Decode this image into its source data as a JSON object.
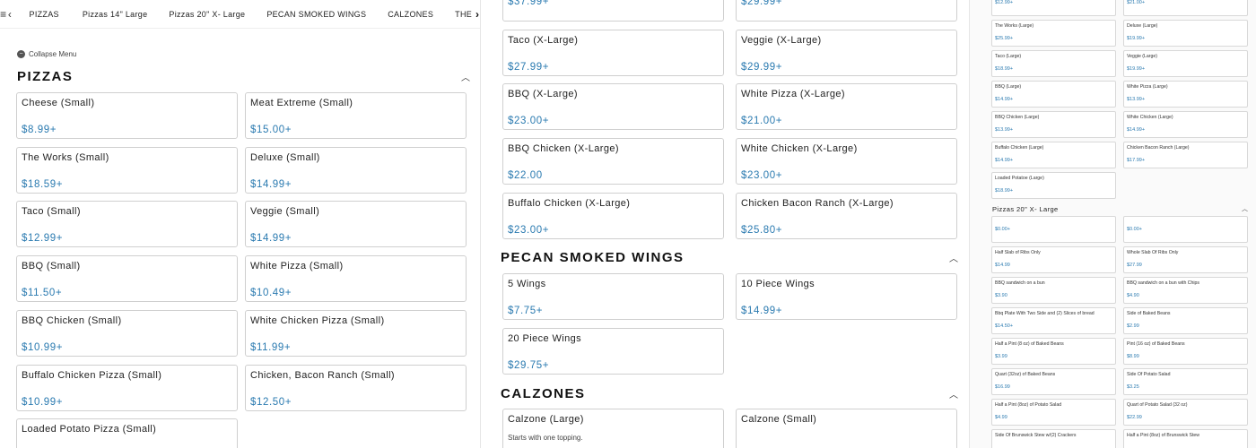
{
  "tabs": {
    "menu_icon": "≡",
    "back_icon": "‹",
    "items": [
      "PIZZAS",
      "Pizzas 14\" Large",
      "Pizzas 20\" X- Large",
      "PECAN SMOKED WINGS",
      "CALZONES",
      "THE PIG C"
    ],
    "next_icon": "›"
  },
  "collapse_menu": {
    "icon": "−",
    "label": "Collapse Menu"
  },
  "pizzas": {
    "title": "PIZZAS",
    "items": [
      {
        "name": "Cheese (Small)",
        "price": "$8.99+"
      },
      {
        "name": "Meat Extreme (Small)",
        "price": "$15.00+"
      },
      {
        "name": "The Works (Small)",
        "price": "$18.59+"
      },
      {
        "name": "Deluxe (Small)",
        "price": "$14.99+"
      },
      {
        "name": "Taco (Small)",
        "price": "$12.99+"
      },
      {
        "name": "Veggie (Small)",
        "price": "$14.99+"
      },
      {
        "name": "BBQ (Small)",
        "price": "$11.50+"
      },
      {
        "name": "White Pizza (Small)",
        "price": "$10.49+"
      },
      {
        "name": "BBQ Chicken (Small)",
        "price": "$10.99+"
      },
      {
        "name": "White Chicken Pizza (Small)",
        "price": "$11.99+"
      },
      {
        "name": "Buffalo Chicken Pizza (Small)",
        "price": "$10.99+"
      },
      {
        "name": "Chicken, Bacon Ranch (Small)",
        "price": "$12.50+"
      },
      {
        "name": "Loaded Potato Pizza (Small)",
        "price": ""
      }
    ]
  },
  "xlarge": {
    "items": [
      {
        "name": "",
        "price": "$37.99+"
      },
      {
        "name": "",
        "price": "$29.99+"
      },
      {
        "name": "Taco (X-Large)",
        "price": "$27.99+"
      },
      {
        "name": "Veggie (X-Large)",
        "price": "$29.99+"
      },
      {
        "name": "BBQ (X-Large)",
        "price": "$23.00+"
      },
      {
        "name": "White Pizza (X-Large)",
        "price": "$21.00+"
      },
      {
        "name": "BBQ Chicken (X-Large)",
        "price": "$22.00"
      },
      {
        "name": "White Chicken (X-Large)",
        "price": "$23.00+"
      },
      {
        "name": "Buffalo Chicken (X-Large)",
        "price": "$23.00+"
      },
      {
        "name": "Chicken Bacon Ranch (X-Large)",
        "price": "$25.80+"
      }
    ]
  },
  "wings": {
    "title": "PECAN SMOKED WINGS",
    "items": [
      {
        "name": "5 Wings",
        "price": "$7.75+"
      },
      {
        "name": "10 Piece Wings",
        "price": "$14.99+"
      },
      {
        "name": "20 Piece Wings",
        "price": "$29.75+"
      }
    ]
  },
  "calzones": {
    "title": "CALZONES",
    "items": [
      {
        "name": "Calzone (Large)",
        "desc": "Starts with one topping."
      },
      {
        "name": "Calzone (Small)",
        "desc": ""
      }
    ]
  },
  "right_large": {
    "items": [
      {
        "name": "",
        "price": "$12.99+"
      },
      {
        "name": "",
        "price": "$21.00+"
      },
      {
        "name": "The Works (Large)",
        "price": "$25.99+"
      },
      {
        "name": "Deluxe (Large)",
        "price": "$19.99+"
      },
      {
        "name": "Taco (Large)",
        "price": "$18.99+"
      },
      {
        "name": "Veggie (Large)",
        "price": "$19.99+"
      },
      {
        "name": "BBQ (Large)",
        "price": "$14.99+"
      },
      {
        "name": "White Pizza (Large)",
        "price": "$13.99+"
      },
      {
        "name": "BBQ Chicken (Large)",
        "price": "$13.99+"
      },
      {
        "name": "White Chicken (Large)",
        "price": "$14.99+"
      },
      {
        "name": "Buffalo Chicken (Large)",
        "price": "$14.99+"
      },
      {
        "name": "Chicken Bacon Ranch (Large)",
        "price": "$17.99+"
      },
      {
        "name": "Loaded Potatoe (Large)",
        "price": "$18.99+"
      }
    ]
  },
  "right_xlarge": {
    "title": "Pizzas 20\" X- Large",
    "items": [
      {
        "name": "",
        "price": "$0.00+"
      },
      {
        "name": "",
        "price": "$0.00+"
      },
      {
        "name": "Half Slab of Ribs Only",
        "price": "$14.99"
      },
      {
        "name": "Whole Slab Of Ribs Only",
        "price": "$27.99"
      },
      {
        "name": "BBQ sandwich on a bun",
        "price": "$3.90"
      },
      {
        "name": "BBQ sandwich on a bun with Chips",
        "price": "$4.90"
      },
      {
        "name": "Bbq Plate With Two Side and (2) Slices of bread",
        "price": "$14.50+"
      },
      {
        "name": "Side of Baked Beans",
        "price": "$2.99"
      },
      {
        "name": "Half a Pint (8 oz) of Baked Beans",
        "price": "$3.99"
      },
      {
        "name": "Pint (16 oz) of Baked Beans",
        "price": "$8.99"
      },
      {
        "name": "Quart (32oz) of Baked Beans",
        "price": "$16.99"
      },
      {
        "name": "Side Of Potato Salad",
        "price": "$3.25"
      },
      {
        "name": "Half a Pint (8oz) of Potato Salad",
        "price": "$4.99"
      },
      {
        "name": "Quart of Potato Salad (32 oz)",
        "price": "$22.99"
      },
      {
        "name": "Side Of Brunswick Stew w/(2) Crackers",
        "price": ""
      },
      {
        "name": "Half a Pint (8oz) of Brunswick Stew",
        "price": ""
      }
    ]
  }
}
